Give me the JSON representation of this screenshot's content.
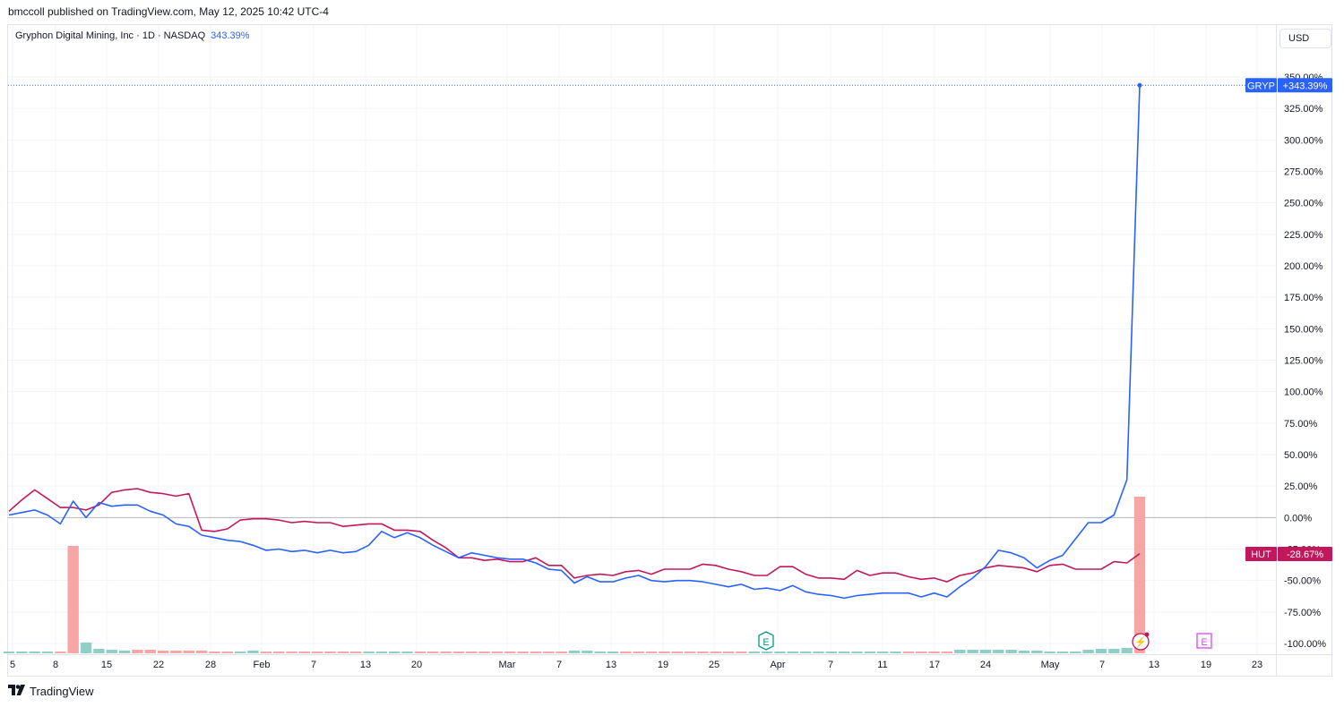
{
  "header": {
    "published_line": "bmccoll published on TradingView.com, May 12, 2025 10:42 UTC-4"
  },
  "legend": {
    "symbol_line": "Gryphon Digital Mining, Inc · 1D · NASDAQ",
    "value": "343.39%"
  },
  "currency_button": "USD",
  "brand": {
    "name": "TradingView",
    "logo_icon": "tradingview-logo-icon"
  },
  "colors": {
    "gryp": "#2962ff",
    "hut": "#c2185b",
    "vol_up": "#8fcfc6",
    "vol_down": "#f7a6a6",
    "zero_line": "#b2b5be"
  },
  "chart_data": {
    "type": "line",
    "ylabel": "",
    "y_unit": "%",
    "ylim": [
      -100,
      350
    ],
    "y_ticks": [
      "350.00%",
      "325.00%",
      "300.00%",
      "275.00%",
      "250.00%",
      "225.00%",
      "200.00%",
      "175.00%",
      "150.00%",
      "125.00%",
      "100.00%",
      "75.00%",
      "50.00%",
      "25.00%",
      "0.00%",
      "-25.00%",
      "-50.00%",
      "-75.00%",
      "-100.00%"
    ],
    "x_ticks": [
      "5",
      "8",
      "15",
      "22",
      "28",
      "Feb",
      "7",
      "13",
      "20",
      "Mar",
      "7",
      "13",
      "19",
      "25",
      "Apr",
      "7",
      "11",
      "17",
      "24",
      "May",
      "7",
      "13",
      "19",
      "23"
    ],
    "x_note": "daily sessions from early Jan 2025 to May 12, 2025 (x = trading-session index)",
    "series": [
      {
        "name": "GRYP",
        "label": "GRYP",
        "last_label": "+343.39%",
        "values": [
          2,
          4,
          6,
          2,
          -5,
          13,
          0,
          12,
          9,
          10,
          10,
          5,
          2,
          -5,
          -7,
          -14,
          -16,
          -18,
          -19,
          -22,
          -26,
          -25,
          -27,
          -26,
          -28,
          -26,
          -28,
          -27,
          -22,
          -11,
          -16,
          -12,
          -16,
          -22,
          -27,
          -32,
          -28,
          -30,
          -32,
          -33,
          -33,
          -36,
          -41,
          -42,
          -52,
          -47,
          -51,
          -51,
          -48,
          -46,
          -50,
          -51,
          -50,
          -50,
          -51,
          -53,
          -55,
          -53,
          -57,
          -56,
          -58,
          -54,
          -59,
          -61,
          -62,
          -64,
          -62,
          -61,
          -60,
          -60,
          -60,
          -63,
          -60,
          -63,
          -55,
          -48,
          -39,
          -26,
          -28,
          -32,
          -40,
          -34,
          -30,
          -17,
          -4,
          -4,
          2,
          30,
          343.39
        ]
      },
      {
        "name": "HUT",
        "label": "HUT",
        "last_label": "-28.67%",
        "values": [
          5,
          14,
          22,
          15,
          8,
          8,
          6,
          10,
          20,
          22,
          23,
          20,
          19,
          17,
          19,
          -10,
          -11,
          -9,
          -2,
          -1,
          -1,
          -2,
          -4,
          -3,
          -4,
          -4,
          -7,
          -6,
          -5,
          -5,
          -10,
          -10,
          -11,
          -18,
          -24,
          -32,
          -32,
          -34,
          -33,
          -35,
          -35,
          -32,
          -38,
          -38,
          -48,
          -46,
          -45,
          -46,
          -43,
          -42,
          -45,
          -41,
          -41,
          -41,
          -37,
          -38,
          -41,
          -43,
          -46,
          -46,
          -39,
          -39,
          -45,
          -48,
          -48,
          -49,
          -42,
          -46,
          -44,
          -44,
          -47,
          -49,
          -48,
          -51,
          -46,
          -44,
          -40,
          -38,
          -39,
          -40,
          -43,
          -38,
          -37,
          -41,
          -41,
          -41,
          -35,
          -36,
          -28.67
        ]
      }
    ],
    "volume": {
      "values": [
        2,
        2,
        2,
        2,
        2,
        120,
        12,
        5,
        4,
        3,
        4,
        4,
        3,
        3,
        3,
        3,
        2,
        2,
        2,
        3,
        2,
        2,
        2,
        2,
        2,
        2,
        2,
        2,
        2,
        2,
        2,
        2,
        2,
        2,
        2,
        2,
        2,
        2,
        2,
        2,
        2,
        2,
        2,
        2,
        3,
        3,
        2,
        2,
        2,
        2,
        2,
        2,
        2,
        2,
        2,
        2,
        2,
        2,
        2,
        2,
        2,
        2,
        2,
        2,
        2,
        2,
        2,
        2,
        2,
        2,
        2,
        2,
        2,
        2,
        4,
        4,
        4,
        4,
        4,
        3,
        3,
        2,
        2,
        2,
        4,
        5,
        5,
        6,
        175
      ],
      "direction": [
        "u",
        "u",
        "u",
        "u",
        "d",
        "d",
        "u",
        "u",
        "u",
        "u",
        "d",
        "d",
        "d",
        "d",
        "d",
        "d",
        "d",
        "d",
        "u",
        "u",
        "d",
        "d",
        "d",
        "d",
        "d",
        "d",
        "d",
        "d",
        "u",
        "u",
        "u",
        "u",
        "d",
        "d",
        "d",
        "d",
        "d",
        "d",
        "d",
        "d",
        "d",
        "d",
        "d",
        "d",
        "u",
        "u",
        "u",
        "u",
        "d",
        "d",
        "d",
        "d",
        "d",
        "d",
        "d",
        "d",
        "d",
        "d",
        "u",
        "u",
        "u",
        "u",
        "u",
        "u",
        "u",
        "u",
        "u",
        "u",
        "u",
        "u",
        "d",
        "d",
        "d",
        "d",
        "u",
        "u",
        "u",
        "u",
        "u",
        "u",
        "u",
        "u",
        "u",
        "u",
        "u",
        "u",
        "u",
        "u",
        "d"
      ]
    },
    "event_markers": [
      {
        "symbol": "E",
        "name": "earnings-marker",
        "color": "#089981",
        "style": "past",
        "x_label": "late-Mar"
      },
      {
        "symbol": "⚡",
        "name": "event-flash-marker",
        "color": "#c2185b",
        "style": "current",
        "x_label": "May-12"
      },
      {
        "symbol": "E",
        "name": "earnings-marker-upcoming",
        "color": "#e040fb",
        "style": "future",
        "x_label": "May-19"
      }
    ],
    "grid": true,
    "legend_placement": "top-left"
  }
}
